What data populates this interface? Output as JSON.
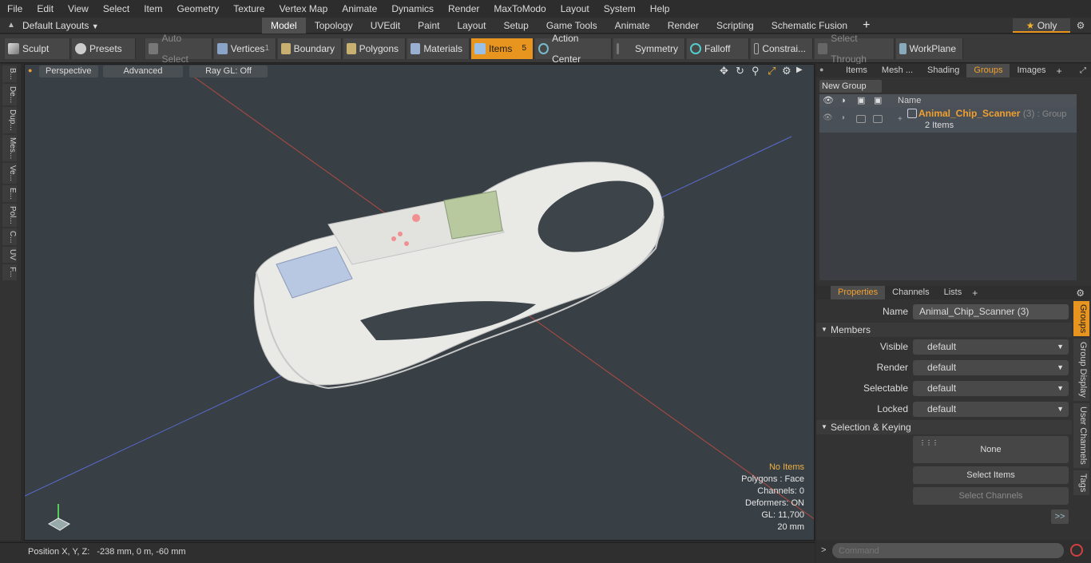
{
  "menu": [
    "File",
    "Edit",
    "View",
    "Select",
    "Item",
    "Geometry",
    "Texture",
    "Vertex Map",
    "Animate",
    "Dynamics",
    "Render",
    "MaxToModo",
    "Layout",
    "System",
    "Help"
  ],
  "layout_selector": "Default Layouts",
  "layout_tabs": [
    "Model",
    "Topology",
    "UVEdit",
    "Paint",
    "Layout",
    "Setup",
    "Game Tools",
    "Animate",
    "Render",
    "Scripting",
    "Schematic Fusion"
  ],
  "active_layout_tab": "Model",
  "only_label": "Only",
  "toolbar": {
    "sculpt": "Sculpt",
    "presets": "Presets",
    "auto_select": "Auto Select",
    "vertices": "Vertices",
    "vertices_count": "1",
    "boundary": "Boundary",
    "polygons": "Polygons",
    "materials": "Materials",
    "items": "Items",
    "items_count": "5",
    "action_center": "Action Center",
    "symmetry": "Symmetry",
    "falloff": "Falloff",
    "constraints": "Constrai...",
    "select_through": "Select Through",
    "workplane": "WorkPlane"
  },
  "left_tabs": [
    "B...",
    "De...",
    "Dup...",
    "Mes...",
    "Ve...",
    "E...",
    "Pol...",
    "C...",
    "UV",
    "F..."
  ],
  "viewport": {
    "view_mode": "Perspective",
    "shading": "Advanced",
    "raygl": "Ray GL: Off",
    "stats": {
      "items": "No Items",
      "polygons": "Polygons : Face",
      "channels": "Channels: 0",
      "deformers": "Deformers: ON",
      "gl": "GL: 11,700",
      "scale": "20 mm"
    }
  },
  "status": {
    "position_label": "Position X, Y, Z:",
    "position_value": "-238 mm, 0 m, -60 mm"
  },
  "right_panel": {
    "top_tabs": [
      "Items",
      "Mesh ...",
      "Shading",
      "Groups",
      "Images"
    ],
    "active_top_tab": "Groups",
    "new_group": "New Group",
    "column_name": "Name",
    "group": {
      "name": "Animal_Chip_Scanner",
      "count": "(3)",
      "type": ": Group",
      "items": "2 Items"
    },
    "bottom_tabs": [
      "Properties",
      "Channels",
      "Lists"
    ],
    "active_bottom_tab": "Properties",
    "props": {
      "name_label": "Name",
      "name_value": "Animal_Chip_Scanner (3)",
      "members_section": "Members",
      "visible_label": "Visible",
      "visible_value": "default",
      "render_label": "Render",
      "render_value": "default",
      "selectable_label": "Selectable",
      "selectable_value": "default",
      "locked_label": "Locked",
      "locked_value": "default",
      "keying_section": "Selection & Keying",
      "none_label": "None",
      "select_items": "Select Items",
      "select_channels": "Select Channels",
      "more": ">>"
    },
    "side_tabs": [
      "Groups",
      "Group Display",
      "User Channels",
      "Tags"
    ],
    "command_placeholder": "Command"
  },
  "colors": {
    "accent": "#e8951f",
    "viewport_bg": "#384046",
    "group_name": "#f0a030"
  }
}
